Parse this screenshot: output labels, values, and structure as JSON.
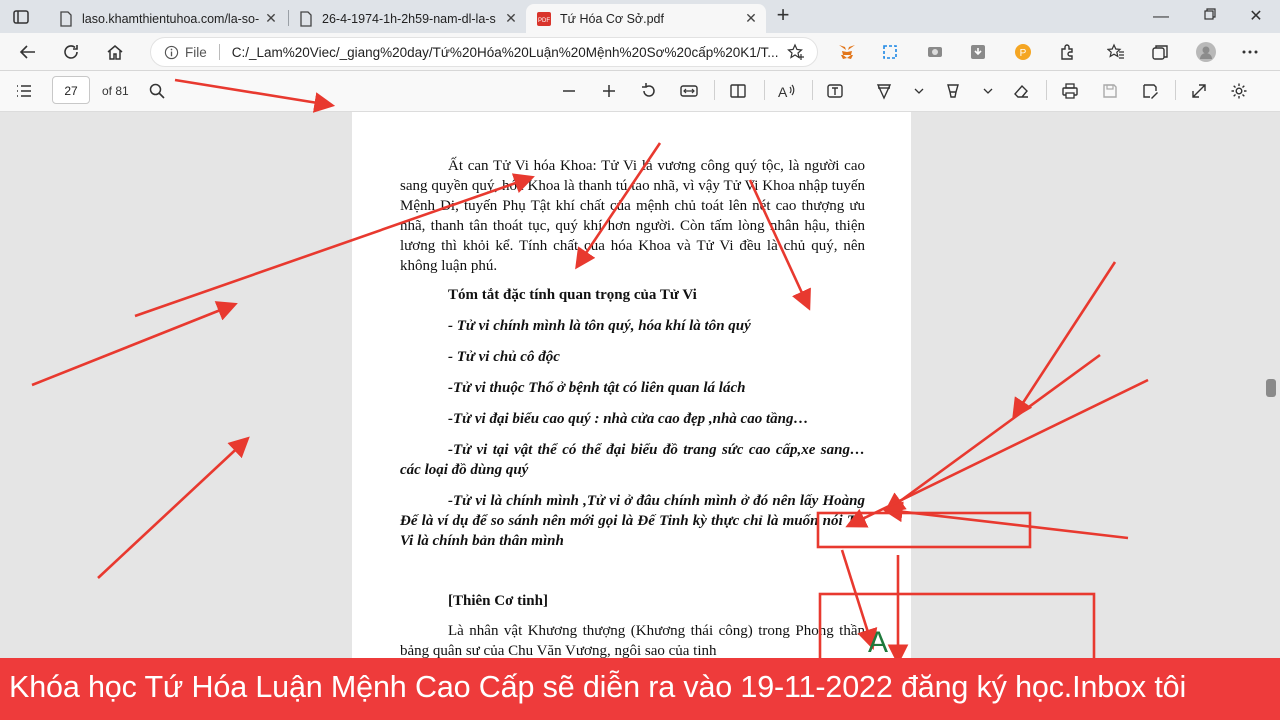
{
  "browser": {
    "tabs": [
      {
        "title": "laso.khamthientuhoa.com/la-so-",
        "active": false
      },
      {
        "title": "26-4-1974-1h-2h59-nam-dl-la-s",
        "active": false
      },
      {
        "title": "Tứ Hóa Cơ Sở.pdf",
        "active": true
      }
    ],
    "address": {
      "scheme": "File",
      "url": "C:/_Lam%20Viec/_giang%20day/Tứ%20Hóa%20Luận%20Mệnh%20Sơ%20cấp%20K1/T..."
    }
  },
  "pdf_toolbar": {
    "page_number": "27",
    "page_count": "of 81"
  },
  "document": {
    "intro": "Ất can Tử Vi hóa Khoa: Tử Vi là vương công quý tộc, là người cao sang quyền quý, hóa Khoa là thanh tú tao nhã, vì vậy Tử Vi Khoa nhập tuyến Mệnh Di, tuyến Phụ Tật khí chất của mệnh chủ toát lên nét cao thượng ưu nhã, thanh tân thoát tục, quý khí hơn người. Còn tấm lòng nhân hậu, thiện lương thì khỏi kể. Tính chất của hóa Khoa và Tử Vi đều là chủ quý, nên không luận phú.",
    "heading": "Tóm tắt đặc tính quan trọng của Tử Vi",
    "bullets": [
      "- Tử vi chính mình là tôn quý, hóa khí là tôn quý",
      "- Tử vi chủ cô độc",
      "-Tử vi thuộc Thổ ở bệnh tật có liên quan lá lách",
      "-Tử vi đại biểu cao quý : nhà cửa cao đẹp ,nhà cao tầng…",
      "-Tử vi tại vật thể có thể đại biểu đồ trang sức cao cấp,xe sang… các loại đồ dùng quý",
      "-Tử vi là chính mình ,Tử vi ở đâu chính mình ở đó nên lấy Hoàng Đế là ví dụ để so sánh nên mới gọi là Đế Tinh kỳ thực chỉ là muốn nói Tử Vi là chính bản thân mình"
    ],
    "section_title": "[Thiên Cơ tinh]",
    "section_intro": "Là nhân vật Khương thượng (Khương thái công) trong Phong thần bảng quân sư của Chu Văn Vương, ngôi sao của tinh"
  },
  "annotation_letter": "A",
  "banner": {
    "text": "Khóa học Tứ Hóa Luận Mệnh Cao Cấp sẽ diễn ra vào 19-11-2022 đăng ký học.Inbox tôi"
  },
  "colors": {
    "annotation_red": "#e8392f",
    "banner_red": "#ee3b3b",
    "letter_green": "#1f7a3c"
  }
}
